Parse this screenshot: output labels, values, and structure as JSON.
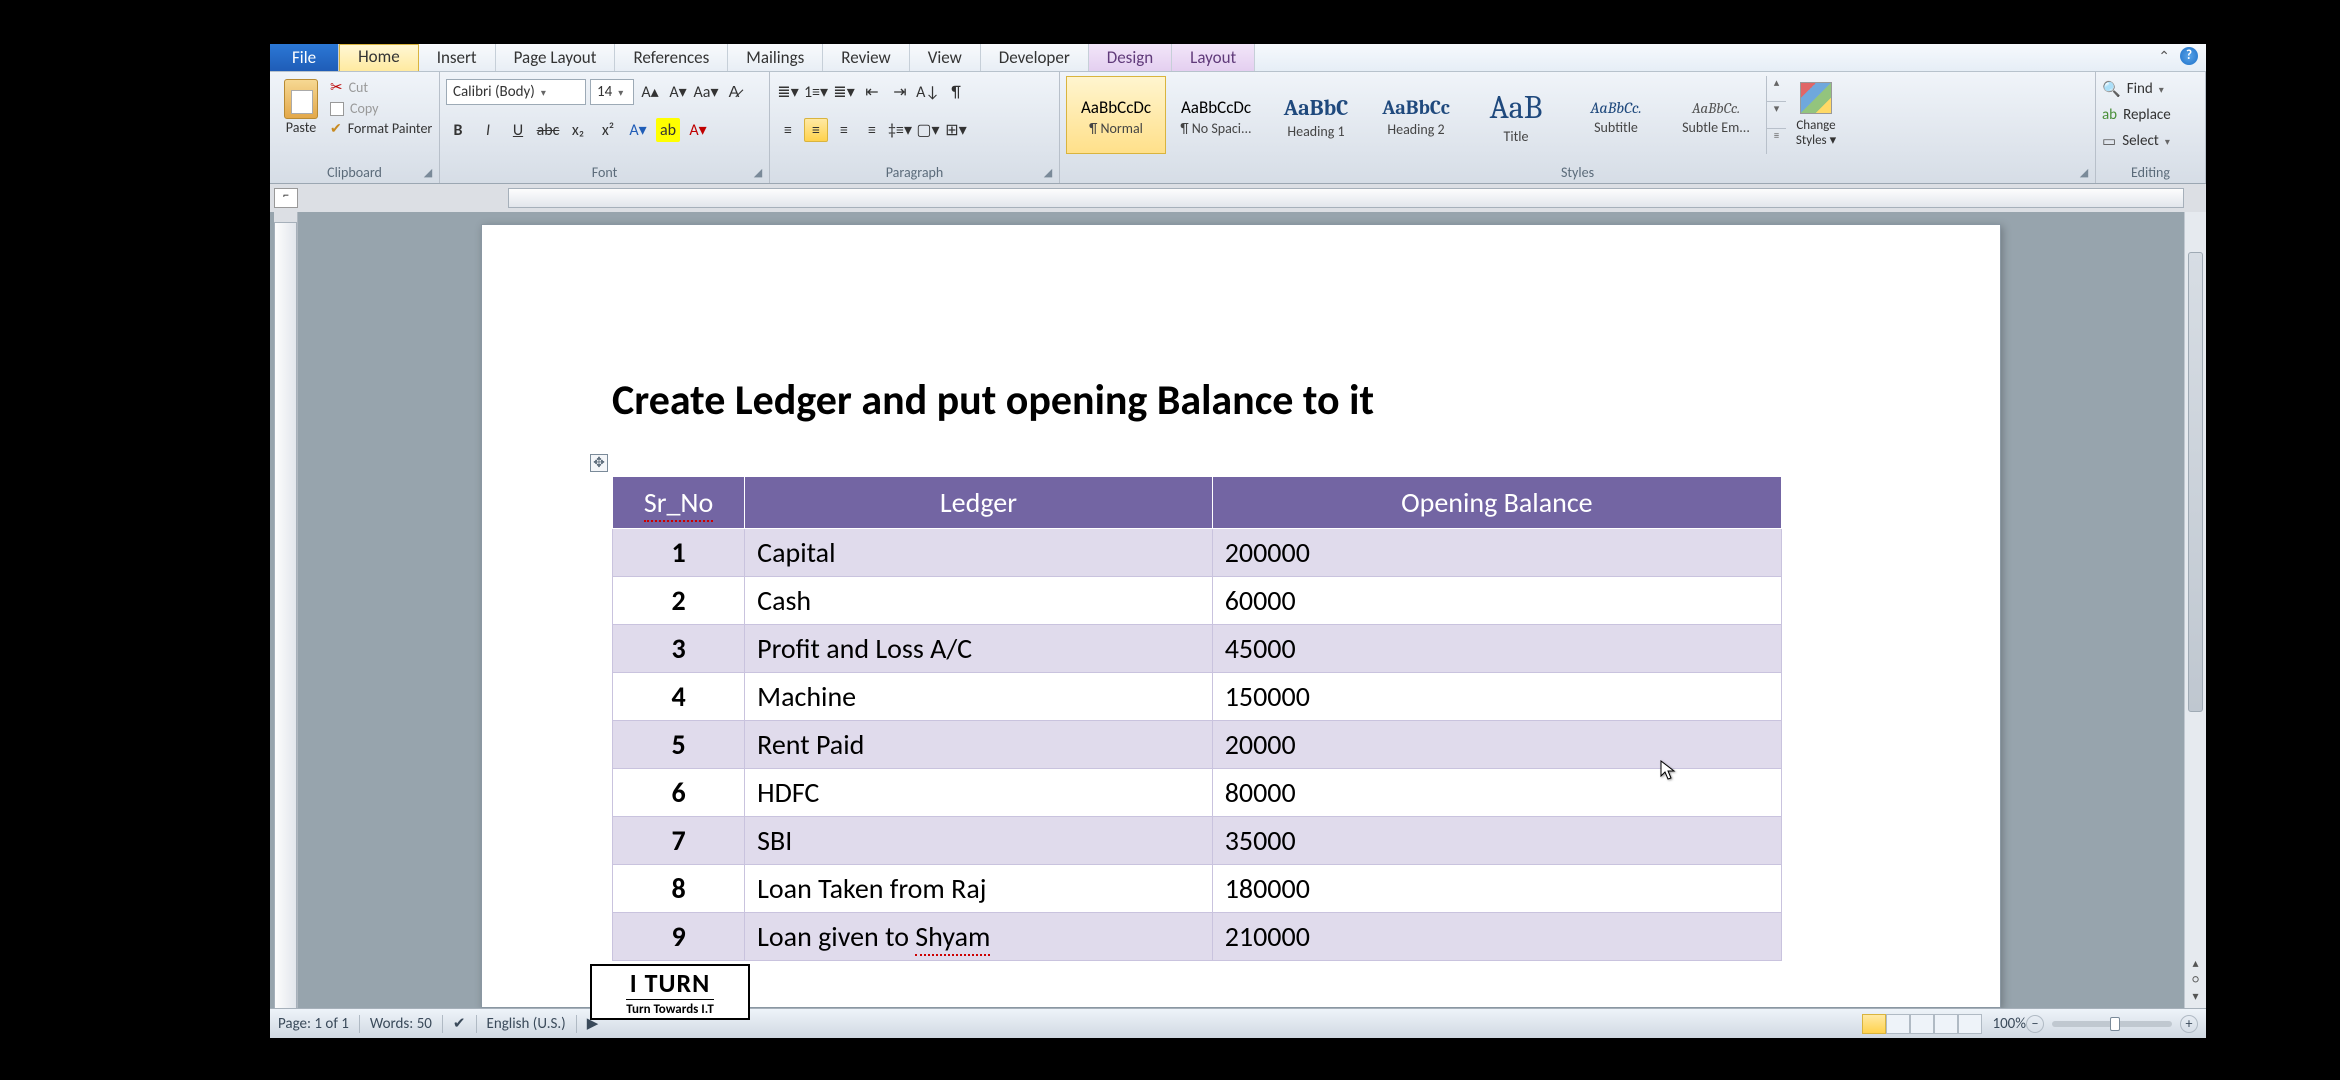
{
  "tabs": {
    "file": "File",
    "home": "Home",
    "insert": "Insert",
    "page_layout": "Page Layout",
    "references": "References",
    "mailings": "Mailings",
    "review": "Review",
    "view": "View",
    "developer": "Developer",
    "design": "Design",
    "layout": "Layout"
  },
  "clipboard": {
    "paste": "Paste",
    "cut": "Cut",
    "copy": "Copy",
    "format_painter": "Format Painter",
    "group_label": "Clipboard"
  },
  "font": {
    "name": "Calibri (Body)",
    "size": "14",
    "group_label": "Font"
  },
  "paragraph": {
    "group_label": "Paragraph"
  },
  "styles": {
    "items": [
      {
        "sample": "AaBbCcDc",
        "label": "¶ Normal",
        "cls": "normal"
      },
      {
        "sample": "AaBbCcDc",
        "label": "¶ No Spaci...",
        "cls": "normal"
      },
      {
        "sample": "AaBbC",
        "label": "Heading 1",
        "cls": "h1"
      },
      {
        "sample": "AaBbCc",
        "label": "Heading 2",
        "cls": "h2"
      },
      {
        "sample": "AaB",
        "label": "Title",
        "cls": "title"
      },
      {
        "sample": "AaBbCc.",
        "label": "Subtitle",
        "cls": "sub"
      },
      {
        "sample": "AaBbCc.",
        "label": "Subtle Em...",
        "cls": "subem"
      }
    ],
    "change_styles": "Change Styles",
    "group_label": "Styles"
  },
  "editing": {
    "find": "Find",
    "replace": "Replace",
    "select": "Select",
    "group_label": "Editing"
  },
  "document": {
    "title": "Create Ledger and put opening Balance to it",
    "columns": {
      "c1": "Sr_No",
      "c2": "Ledger",
      "c3": "Opening Balance"
    },
    "rows": [
      {
        "sr": "1",
        "ledger": "Capital",
        "bal": "200000"
      },
      {
        "sr": "2",
        "ledger": "Cash",
        "bal": "60000"
      },
      {
        "sr": "3",
        "ledger": "Profit and Loss A/C",
        "bal": "45000"
      },
      {
        "sr": "4",
        "ledger": "Machine",
        "bal": "150000"
      },
      {
        "sr": "5",
        "ledger": "Rent Paid",
        "bal": "20000"
      },
      {
        "sr": "6",
        "ledger": "HDFC",
        "bal": "80000"
      },
      {
        "sr": "7",
        "ledger": "SBI",
        "bal": "35000"
      },
      {
        "sr": "8",
        "ledger": "Loan Taken from Raj",
        "bal": "180000"
      },
      {
        "sr": "9",
        "ledger_pre": "Loan given to ",
        "ledger_err": "Shyam",
        "bal": "210000"
      }
    ]
  },
  "status": {
    "page": "Page: 1 of 1",
    "words": "Words: 50",
    "language": "English (U.S.)",
    "zoom": "100%"
  },
  "logo": {
    "main": "I TURN",
    "sub": "Turn Towards I.T"
  }
}
